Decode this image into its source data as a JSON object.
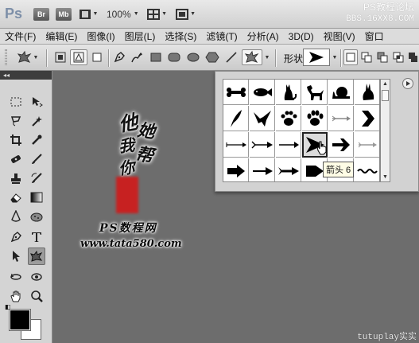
{
  "app": {
    "logo": "Ps",
    "bridge": "Br",
    "minibridge": "Mb",
    "zoom": "100%"
  },
  "watermark": {
    "line1": "PS教程论坛",
    "line2": "BBS.16XX8.COM",
    "bottom": "tutuplay实实"
  },
  "menu": [
    "文件(F)",
    "编辑(E)",
    "图像(I)",
    "图层(L)",
    "选择(S)",
    "滤镜(T)",
    "分析(A)",
    "3D(D)",
    "视图(V)",
    "窗口"
  ],
  "options": {
    "shape_label": "形状:"
  },
  "toolbox": {
    "header": "◂◂"
  },
  "canvas": {
    "callig1": "他",
    "callig2": "她",
    "callig3": "我",
    "callig4": "帮",
    "callig5": "你",
    "brand": "PS数程网",
    "site": "www.tata580.com"
  },
  "picker": {
    "tooltip": "箭头 6",
    "shapes": [
      "bone",
      "fish",
      "cat",
      "dog",
      "snail",
      "rabbit",
      "feather",
      "bird",
      "paw",
      "paw2",
      "arrow-feather",
      "chevron",
      "arrow-thin",
      "arrow-tail",
      "arrow-plain",
      "arrow-dart",
      "arrow-bold",
      "arrow-grey",
      "arrow-block",
      "arrow-long",
      "arrow-feathered",
      "arrow-pointer",
      "arrow-split",
      "wave"
    ]
  },
  "colors": {
    "foreground": "#000000",
    "background": "#ffffff"
  }
}
